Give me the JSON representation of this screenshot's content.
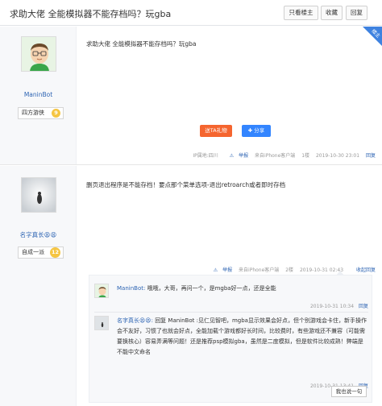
{
  "header": {
    "title": "求助大佬 全能模拟器不能存档吗？玩gba",
    "buttons": [
      "只看楼主",
      "收藏",
      "回复"
    ]
  },
  "post1": {
    "ribbon": "楼主",
    "author": "ManinBot",
    "tag": "四方游侠",
    "level": "9",
    "content": "求助大佬 全能模拟器不能存档吗？玩gba",
    "gift": "送TA礼物",
    "share": "分享",
    "meta": {
      "location": "IP属地:四川",
      "report": "举报",
      "client": "来自iPhone客户端",
      "floor": "1楼",
      "time": "2019-10-30 23:01",
      "reply": "回复"
    }
  },
  "post2": {
    "author": "名字真长😫😫",
    "tag": "自成一派",
    "level": "12",
    "content": "删页退出程序是不能存档！要点那个菜单选项-退出retroarch或者即时存档",
    "meta": {
      "report": "举报",
      "client": "来自iPhone客户端",
      "floor": "2楼",
      "time": "2019-10-31 02:43",
      "collapse": "收起回复"
    }
  },
  "replies": [
    {
      "author": "ManinBot:",
      "text": "哦哦，大哥，再问一个，是mgba好一点，还是全能",
      "time": "2019-10-31 10:34",
      "reply": "回复"
    },
    {
      "author": "名字真长😫😫:",
      "text": "回复 ManinBot :见仁见智吧，mgba显示效果会好点，但个别游戏会卡住，新手操作会不友好，习惯了也就会好点，全能加载个游戏都好长时间，比较费时，有些游戏还不兼容（可能需要换核心）容易弄满等问题！还是推荐psp模拟gba，虽然是二度模拟，但是软件比较成熟！弊端是不能中文命名",
      "time": "2019-10-31 13:41",
      "reply": "回复"
    }
  ],
  "say_button": "我也说一句"
}
